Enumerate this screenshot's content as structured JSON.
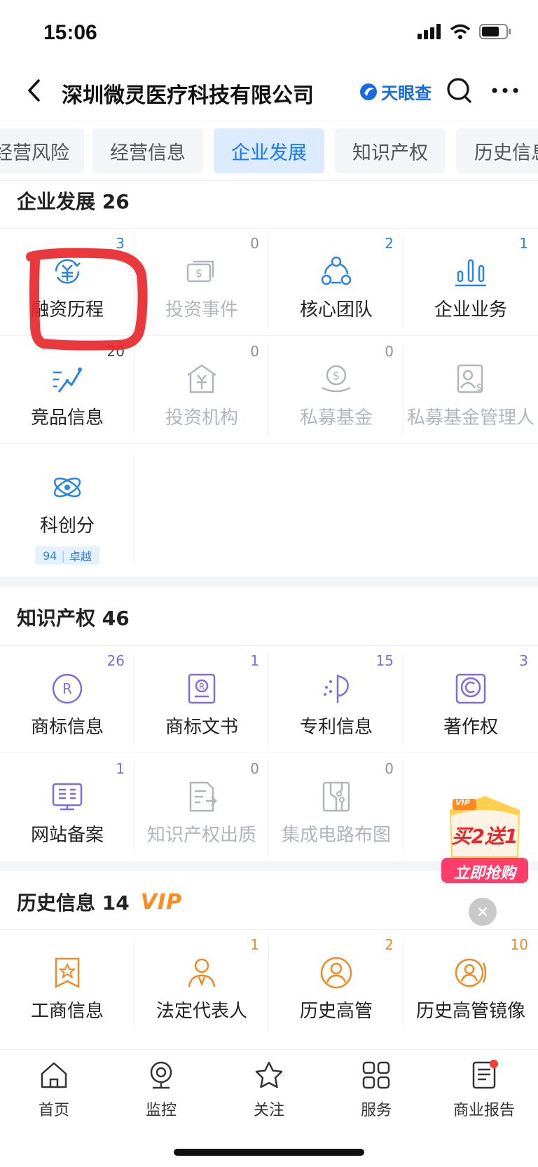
{
  "status_bar": {
    "time": "15:06"
  },
  "nav": {
    "title": "深圳微灵医疗科技有限公司",
    "logo_text": "天眼查"
  },
  "tabs": [
    {
      "label": "经营风险",
      "active": false
    },
    {
      "label": "经营信息",
      "active": false
    },
    {
      "label": "企业发展",
      "active": true
    },
    {
      "label": "知识产权",
      "active": false
    },
    {
      "label": "历史信息",
      "active": false
    }
  ],
  "sections": {
    "development": {
      "title": "企业发展",
      "count": "26",
      "items": [
        {
          "label": "融资历程",
          "count": "3",
          "icon": "financing-icon"
        },
        {
          "label": "投资事件",
          "count": "0",
          "icon": "investment-event-icon"
        },
        {
          "label": "核心团队",
          "count": "2",
          "icon": "core-team-icon"
        },
        {
          "label": "企业业务",
          "count": "1",
          "icon": "business-chart-icon"
        },
        {
          "label": "竞品信息",
          "count": "20",
          "icon": "competitor-trend-icon"
        },
        {
          "label": "投资机构",
          "count": "0",
          "icon": "investment-institution-icon"
        },
        {
          "label": "私募基金",
          "count": "0",
          "icon": "private-fund-icon"
        },
        {
          "label": "私募基金管理人",
          "count": "",
          "icon": "fund-manager-icon"
        },
        {
          "label": "科创分",
          "count": "",
          "icon": "tech-score-icon",
          "score": "94",
          "level": "卓越"
        }
      ]
    },
    "ip": {
      "title": "知识产权",
      "count": "46",
      "items": [
        {
          "label": "商标信息",
          "count": "26",
          "icon": "trademark-icon"
        },
        {
          "label": "商标文书",
          "count": "1",
          "icon": "trademark-document-icon"
        },
        {
          "label": "专利信息",
          "count": "15",
          "icon": "patent-icon"
        },
        {
          "label": "著作权",
          "count": "3",
          "icon": "copyright-icon"
        },
        {
          "label": "网站备案",
          "count": "1",
          "icon": "website-filing-icon"
        },
        {
          "label": "知识产权出质",
          "count": "0",
          "icon": "ip-pledge-icon"
        },
        {
          "label": "集成电路布图",
          "count": "0",
          "icon": "circuit-layout-icon"
        }
      ]
    },
    "history": {
      "title": "历史信息",
      "count": "14",
      "badge": "VIP",
      "items": [
        {
          "label": "工商信息",
          "count": "",
          "icon": "business-registration-icon"
        },
        {
          "label": "法定代表人",
          "count": "1",
          "icon": "legal-representative-icon"
        },
        {
          "label": "历史高管",
          "count": "2",
          "icon": "former-executive-icon"
        },
        {
          "label": "历史高管镜像",
          "count": "10",
          "icon": "executive-mirror-icon"
        }
      ]
    }
  },
  "promo": {
    "vip": "VIP",
    "line1": "买2送1",
    "line2": "立即抢购"
  },
  "bottom_nav": [
    {
      "label": "首页",
      "icon": "home-icon"
    },
    {
      "label": "监控",
      "icon": "monitor-icon"
    },
    {
      "label": "关注",
      "icon": "star-icon"
    },
    {
      "label": "服务",
      "icon": "services-icon"
    },
    {
      "label": "商业报告",
      "icon": "report-icon"
    }
  ],
  "colors": {
    "accent": "#1677ff",
    "vip": "#ff8a1f",
    "ip_purple": "#7b6ee6",
    "history_orange": "#f08a24",
    "annotation_red": "#e8272c"
  }
}
